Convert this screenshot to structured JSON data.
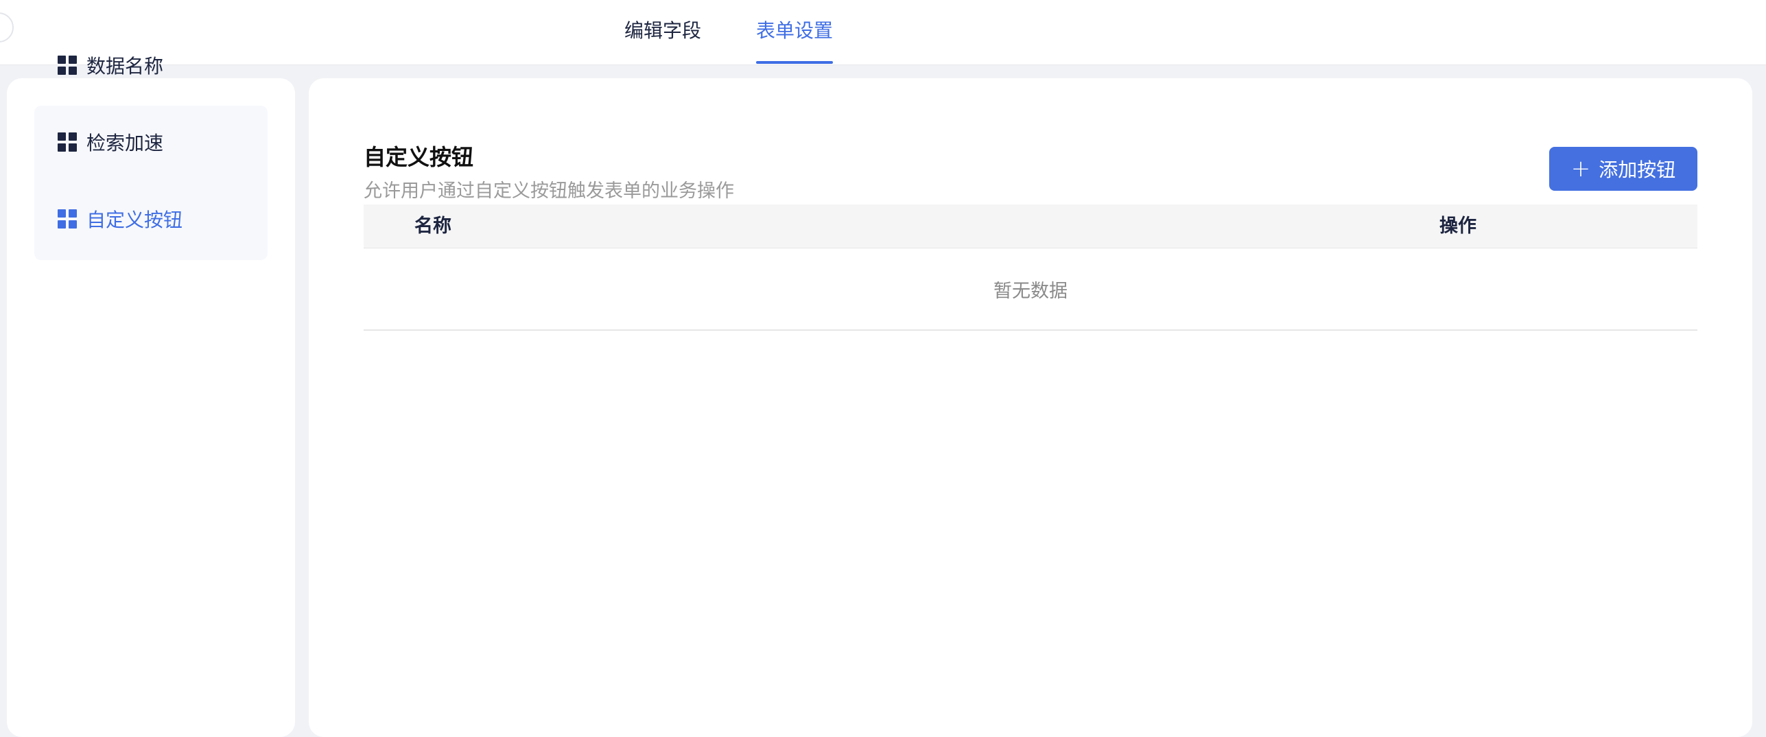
{
  "header": {
    "tabs": [
      {
        "label": "编辑字段",
        "active": false
      },
      {
        "label": "表单设置",
        "active": true
      }
    ]
  },
  "sidebar": {
    "items": [
      {
        "label": "数据名称",
        "icon": "grid-icon",
        "active": false
      },
      {
        "label": "检索加速",
        "icon": "grid-icon",
        "active": false
      },
      {
        "label": "自定义按钮",
        "icon": "grid-icon",
        "active": true
      }
    ]
  },
  "main": {
    "title": "自定义按钮",
    "description": "允许用户通过自定义按钮触发表单的业务操作",
    "add_button_label": "添加按钮",
    "add_button_icon": "plus-icon",
    "table": {
      "columns": [
        "名称",
        "操作"
      ],
      "empty_text": "暂无数据"
    }
  },
  "colors": {
    "accent": "#3f6ee4",
    "button": "#4470e0",
    "background": "#f1f2f6"
  }
}
